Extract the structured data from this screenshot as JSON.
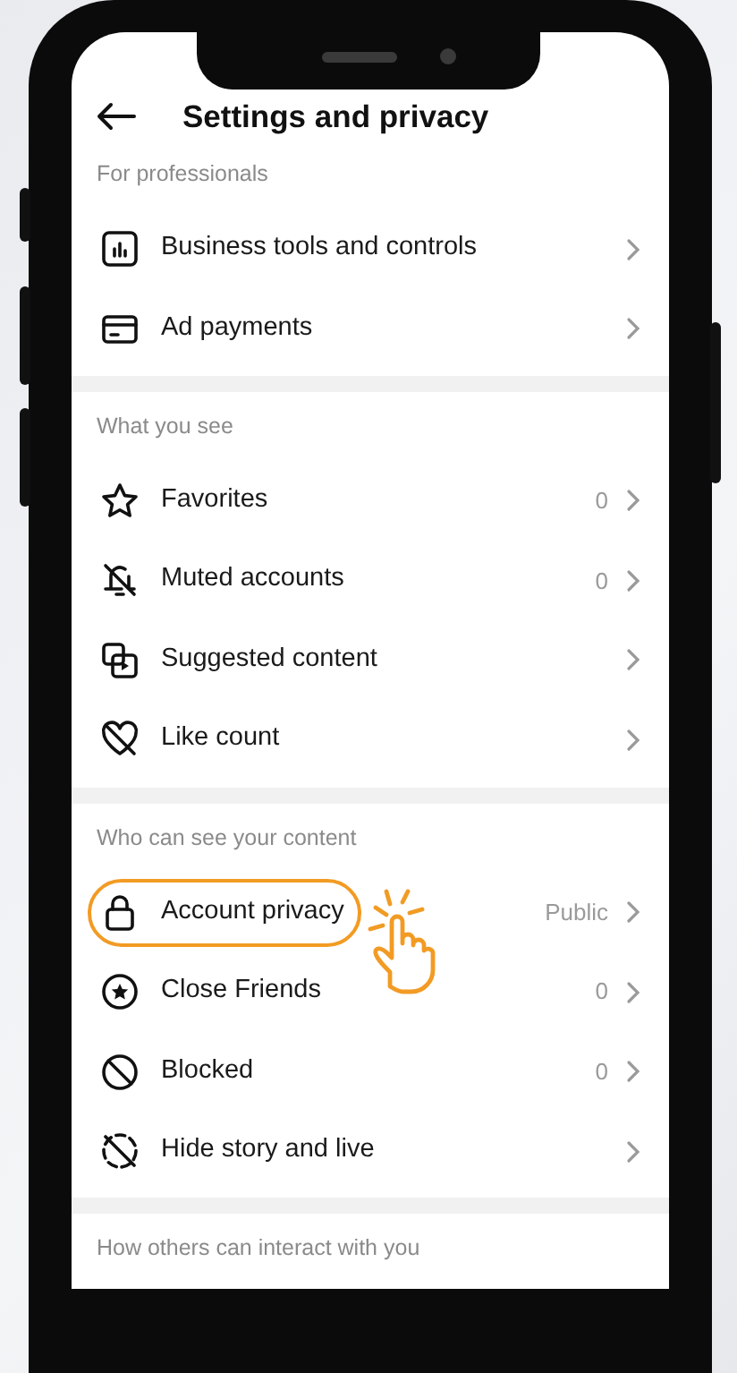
{
  "header": {
    "title": "Settings and privacy"
  },
  "sections": [
    {
      "heading": "For professionals",
      "items": [
        {
          "label": "Business tools and controls",
          "highlighted": false
        },
        {
          "label": "Ad payments",
          "highlighted": false
        }
      ]
    },
    {
      "heading": "What you see",
      "items": [
        {
          "label": "Favorites",
          "value": "0",
          "highlighted": false
        },
        {
          "label": "Muted accounts",
          "value": "0",
          "highlighted": false
        },
        {
          "label": "Suggested content",
          "highlighted": false
        },
        {
          "label": "Like count",
          "highlighted": false
        }
      ]
    },
    {
      "heading": "Who can see your content",
      "items": [
        {
          "label": "Account privacy",
          "value": "Public",
          "highlighted": true
        },
        {
          "label": "Close Friends",
          "value": "0",
          "highlighted": false
        },
        {
          "label": "Blocked",
          "value": "0",
          "highlighted": false
        },
        {
          "label": "Hide story and live",
          "highlighted": false
        }
      ]
    },
    {
      "heading": "How others can interact with you"
    }
  ]
}
